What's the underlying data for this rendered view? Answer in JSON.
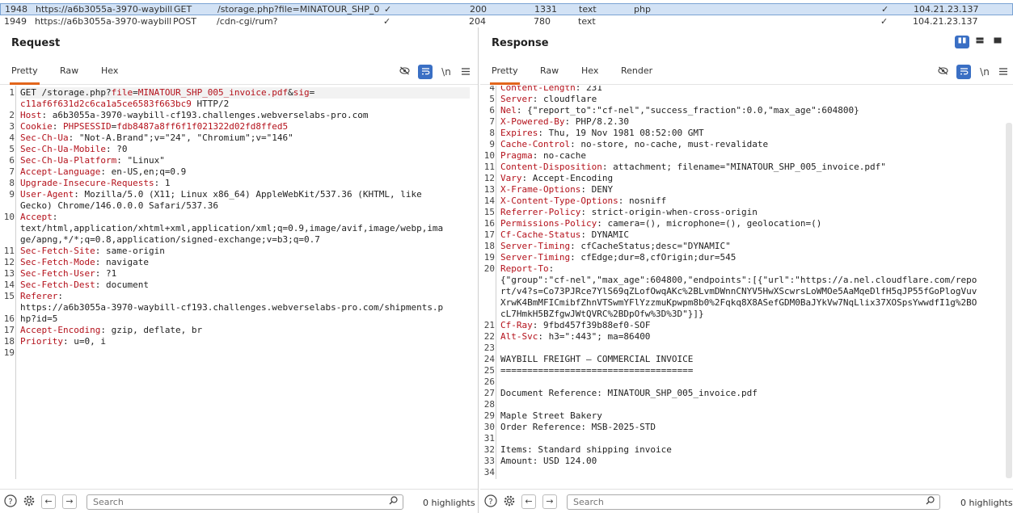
{
  "history": [
    {
      "num": "1948",
      "url": "https://a6b3055a-3970-waybill...",
      "method": "GET",
      "path": "/storage.php?file=MINATOUR_SHP_0...",
      "check": "✓",
      "status": "200",
      "length": "1331",
      "mime": "text",
      "ext": "php",
      "tls": "✓",
      "ip": "104.21.23.137"
    },
    {
      "num": "1949",
      "url": "https://a6b3055a-3970-waybill...",
      "method": "POST",
      "path": "/cdn-cgi/rum?",
      "check": "✓",
      "status": "204",
      "length": "780",
      "mime": "text",
      "ext": "",
      "tls": "✓",
      "ip": "104.21.23.137"
    }
  ],
  "request": {
    "title": "Request",
    "tabs": [
      "Pretty",
      "Raw",
      "Hex"
    ],
    "line_numbers": [
      "1",
      "",
      "2",
      "3",
      "4",
      "5",
      "6",
      "7",
      "8",
      "9",
      "",
      "10",
      "",
      "",
      "11",
      "12",
      "13",
      "14",
      "15",
      "",
      "16",
      "17",
      "18",
      "19"
    ],
    "lines": [
      {
        "parts": [
          {
            "t": "GET /storage.php?",
            "c": ""
          },
          {
            "t": "file",
            "c": "k"
          },
          {
            "t": "=",
            "c": ""
          },
          {
            "t": "MINATOUR_SHP_005_invoice.pdf",
            "c": "k"
          },
          {
            "t": "&",
            "c": ""
          },
          {
            "t": "sig",
            "c": "k"
          },
          {
            "t": "=",
            "c": ""
          }
        ]
      },
      {
        "parts": [
          {
            "t": "c11af6f631d2c6ca1a5ce6583f663bc9",
            "c": "k"
          },
          {
            "t": " HTTP/2",
            "c": ""
          }
        ]
      },
      {
        "parts": [
          {
            "t": "Host",
            "c": "k"
          },
          {
            "t": ": a6b3055a-3970-waybill-cf193.challenges.webverselabs-pro.com",
            "c": ""
          }
        ]
      },
      {
        "parts": [
          {
            "t": "Cookie",
            "c": "k"
          },
          {
            "t": ": ",
            "c": ""
          },
          {
            "t": "PHPSESSID",
            "c": "k"
          },
          {
            "t": "=",
            "c": ""
          },
          {
            "t": "fdb8487a8ff6f1f021322d02fd8ffed5",
            "c": "k"
          }
        ]
      },
      {
        "parts": [
          {
            "t": "Sec-Ch-Ua",
            "c": "k"
          },
          {
            "t": ": \"Not-A.Brand\";v=\"24\", \"Chromium\";v=\"146\"",
            "c": ""
          }
        ]
      },
      {
        "parts": [
          {
            "t": "Sec-Ch-Ua-Mobile",
            "c": "k"
          },
          {
            "t": ": ?0",
            "c": ""
          }
        ]
      },
      {
        "parts": [
          {
            "t": "Sec-Ch-Ua-Platform",
            "c": "k"
          },
          {
            "t": ": \"Linux\"",
            "c": ""
          }
        ]
      },
      {
        "parts": [
          {
            "t": "Accept-Language",
            "c": "k"
          },
          {
            "t": ": en-US,en;q=0.9",
            "c": ""
          }
        ]
      },
      {
        "parts": [
          {
            "t": "Upgrade-Insecure-Requests",
            "c": "k"
          },
          {
            "t": ": 1",
            "c": ""
          }
        ]
      },
      {
        "parts": [
          {
            "t": "User-Agent",
            "c": "k"
          },
          {
            "t": ": Mozilla/5.0 (X11; Linux x86_64) AppleWebKit/537.36 (KHTML, like",
            "c": ""
          }
        ]
      },
      {
        "parts": [
          {
            "t": "Gecko) Chrome/146.0.0.0 Safari/537.36",
            "c": ""
          }
        ]
      },
      {
        "parts": [
          {
            "t": "Accept",
            "c": "k"
          },
          {
            "t": ":",
            "c": ""
          }
        ]
      },
      {
        "parts": [
          {
            "t": "text/html,application/xhtml+xml,application/xml;q=0.9,image/avif,image/webp,ima",
            "c": ""
          }
        ]
      },
      {
        "parts": [
          {
            "t": "ge/apng,*/*;q=0.8,application/signed-exchange;v=b3;q=0.7",
            "c": ""
          }
        ]
      },
      {
        "parts": [
          {
            "t": "Sec-Fetch-Site",
            "c": "k"
          },
          {
            "t": ": same-origin",
            "c": ""
          }
        ]
      },
      {
        "parts": [
          {
            "t": "Sec-Fetch-Mode",
            "c": "k"
          },
          {
            "t": ": navigate",
            "c": ""
          }
        ]
      },
      {
        "parts": [
          {
            "t": "Sec-Fetch-User",
            "c": "k"
          },
          {
            "t": ": ?1",
            "c": ""
          }
        ]
      },
      {
        "parts": [
          {
            "t": "Sec-Fetch-Dest",
            "c": "k"
          },
          {
            "t": ": document",
            "c": ""
          }
        ]
      },
      {
        "parts": [
          {
            "t": "Referer",
            "c": "k"
          },
          {
            "t": ":",
            "c": ""
          }
        ]
      },
      {
        "parts": [
          {
            "t": "https://a6b3055a-3970-waybill-cf193.challenges.webverselabs-pro.com/shipments.p",
            "c": ""
          }
        ]
      },
      {
        "parts": [
          {
            "t": "hp?id=5",
            "c": ""
          }
        ]
      },
      {
        "parts": [
          {
            "t": "Accept-Encoding",
            "c": "k"
          },
          {
            "t": ": gzip, deflate, br",
            "c": ""
          }
        ]
      },
      {
        "parts": [
          {
            "t": "Priority",
            "c": "k"
          },
          {
            "t": ": u=0, i",
            "c": ""
          }
        ]
      },
      {
        "parts": []
      },
      {
        "parts": []
      }
    ],
    "search_placeholder": "Search",
    "highlights": "0 highlights"
  },
  "response": {
    "title": "Response",
    "tabs": [
      "Pretty",
      "Raw",
      "Hex",
      "Render"
    ],
    "line_numbers": [
      "4",
      "5",
      "6",
      "7",
      "8",
      "9",
      "10",
      "11",
      "12",
      "13",
      "14",
      "15",
      "16",
      "17",
      "18",
      "19",
      "20",
      "",
      "",
      "",
      "",
      "21",
      "22",
      "23",
      "24",
      "25",
      "26",
      "27",
      "28",
      "29",
      "30",
      "31",
      "32",
      "33",
      "34"
    ],
    "lines": [
      {
        "parts": [
          {
            "t": "Content-Length",
            "c": "k"
          },
          {
            "t": ": 231",
            "c": ""
          }
        ]
      },
      {
        "parts": [
          {
            "t": "Server",
            "c": "k"
          },
          {
            "t": ": cloudflare",
            "c": ""
          }
        ]
      },
      {
        "parts": [
          {
            "t": "Nel",
            "c": "k"
          },
          {
            "t": ": {\"report_to\":\"cf-nel\",\"success_fraction\":0.0,\"max_age\":604800}",
            "c": ""
          }
        ]
      },
      {
        "parts": [
          {
            "t": "X-Powered-By",
            "c": "k"
          },
          {
            "t": ": PHP/8.2.30",
            "c": ""
          }
        ]
      },
      {
        "parts": [
          {
            "t": "Expires",
            "c": "k"
          },
          {
            "t": ": Thu, 19 Nov 1981 08:52:00 GMT",
            "c": ""
          }
        ]
      },
      {
        "parts": [
          {
            "t": "Cache-Control",
            "c": "k"
          },
          {
            "t": ": no-store, no-cache, must-revalidate",
            "c": ""
          }
        ]
      },
      {
        "parts": [
          {
            "t": "Pragma",
            "c": "k"
          },
          {
            "t": ": no-cache",
            "c": ""
          }
        ]
      },
      {
        "parts": [
          {
            "t": "Content-Disposition",
            "c": "k"
          },
          {
            "t": ": attachment; filename=\"MINATOUR_SHP_005_invoice.pdf\"",
            "c": ""
          }
        ]
      },
      {
        "parts": [
          {
            "t": "Vary",
            "c": "k"
          },
          {
            "t": ": Accept-Encoding",
            "c": ""
          }
        ]
      },
      {
        "parts": [
          {
            "t": "X-Frame-Options",
            "c": "k"
          },
          {
            "t": ": DENY",
            "c": ""
          }
        ]
      },
      {
        "parts": [
          {
            "t": "X-Content-Type-Options",
            "c": "k"
          },
          {
            "t": ": nosniff",
            "c": ""
          }
        ]
      },
      {
        "parts": [
          {
            "t": "Referrer-Policy",
            "c": "k"
          },
          {
            "t": ": strict-origin-when-cross-origin",
            "c": ""
          }
        ]
      },
      {
        "parts": [
          {
            "t": "Permissions-Policy",
            "c": "k"
          },
          {
            "t": ": camera=(), microphone=(), geolocation=()",
            "c": ""
          }
        ]
      },
      {
        "parts": [
          {
            "t": "Cf-Cache-Status",
            "c": "k"
          },
          {
            "t": ": DYNAMIC",
            "c": ""
          }
        ]
      },
      {
        "parts": [
          {
            "t": "Server-Timing",
            "c": "k"
          },
          {
            "t": ": cfCacheStatus;desc=\"DYNAMIC\"",
            "c": ""
          }
        ]
      },
      {
        "parts": [
          {
            "t": "Server-Timing",
            "c": "k"
          },
          {
            "t": ": cfEdge;dur=8,cfOrigin;dur=545",
            "c": ""
          }
        ]
      },
      {
        "parts": [
          {
            "t": "Report-To",
            "c": "k"
          },
          {
            "t": ":",
            "c": ""
          }
        ]
      },
      {
        "parts": [
          {
            "t": "{\"group\":\"cf-nel\",\"max_age\":604800,\"endpoints\":[{\"url\":\"https://a.nel.cloudflare.com/repo",
            "c": ""
          }
        ]
      },
      {
        "parts": [
          {
            "t": "rt/v4?s=Co73PJRce7YlS69qZLofOwqAKc%2BLvmDWnnCNYV5HwXScwrsLoWMOe5AaMqeDlfH5qJP55fGoPlogVuv",
            "c": ""
          }
        ]
      },
      {
        "parts": [
          {
            "t": "XrwK4BmMFICmibfZhnVTSwmYFlYzzmuKpwpm8b0%2Fqkq8X8ASefGDM0BaJYkVw7NqLlix37XOSpsYwwdfI1g%2BO",
            "c": ""
          }
        ]
      },
      {
        "parts": [
          {
            "t": "cL7HmkH5BZfgwJWtQVRC%2BDpOfw%3D%3D\"}]}",
            "c": ""
          }
        ]
      },
      {
        "parts": [
          {
            "t": "Cf-Ray",
            "c": "k"
          },
          {
            "t": ": 9fbd457f39b88ef0-SOF",
            "c": ""
          }
        ]
      },
      {
        "parts": [
          {
            "t": "Alt-Svc",
            "c": "k"
          },
          {
            "t": ": h3=\":443\"; ma=86400",
            "c": ""
          }
        ]
      },
      {
        "parts": []
      },
      {
        "parts": [
          {
            "t": "WAYBILL FREIGHT — COMMERCIAL INVOICE",
            "c": ""
          }
        ]
      },
      {
        "parts": [
          {
            "t": "====================================",
            "c": ""
          }
        ]
      },
      {
        "parts": []
      },
      {
        "parts": [
          {
            "t": "Document Reference: MINATOUR_SHP_005_invoice.pdf",
            "c": ""
          }
        ]
      },
      {
        "parts": []
      },
      {
        "parts": [
          {
            "t": "Maple Street Bakery",
            "c": ""
          }
        ]
      },
      {
        "parts": [
          {
            "t": "Order Reference: MSB-2025-STD",
            "c": ""
          }
        ]
      },
      {
        "parts": []
      },
      {
        "parts": [
          {
            "t": "Items: Standard shipping invoice",
            "c": ""
          }
        ]
      },
      {
        "parts": [
          {
            "t": "Amount: USD 124.00",
            "c": ""
          }
        ]
      },
      {
        "parts": []
      }
    ],
    "search_placeholder": "Search",
    "highlights": "0 highlights"
  },
  "icons": {
    "hide": "eye-off-icon",
    "wrap": "wrap-lines-icon",
    "newline": "\\n",
    "menu": "hamburger-menu-icon",
    "help": "help-icon",
    "settings": "gear-icon",
    "back": "arrow-left-icon",
    "forward": "arrow-right-icon",
    "search": "search-icon",
    "layout_split": "split-view-icon",
    "layout_horizontal": "horizontal-view-icon",
    "layout_single": "single-view-icon"
  },
  "colors": {
    "accent": "#e2651b",
    "keyword": "#b4111b",
    "selected_row": "#d2e2f5",
    "button_blue": "#3a6fc4"
  }
}
